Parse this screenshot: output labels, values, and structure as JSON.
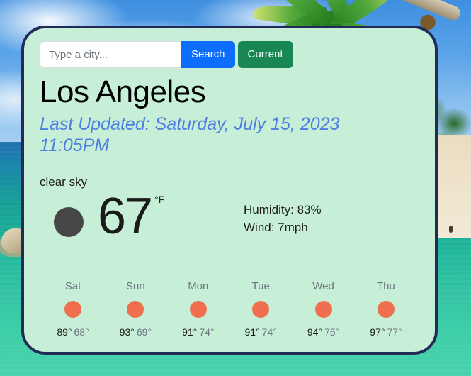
{
  "background": {
    "scene": "tropical-beach-palm-tree",
    "sky_color": "#5aa3e8",
    "ocean_color": "#2fb9a8",
    "sand_color": "#efe4cc"
  },
  "card": {
    "background_color": "#c7efd7",
    "border_color": "#222b58"
  },
  "search": {
    "placeholder": "Type a city...",
    "value": "",
    "search_label": "Search",
    "current_label": "Current",
    "search_color": "#0d6efd",
    "current_color": "#198754"
  },
  "current": {
    "city": "Los Angeles",
    "last_updated": "Last Updated: Saturday, July 15, 2023 11:05PM",
    "condition": "clear sky",
    "icon": "clear-sky-icon",
    "icon_color": "#464646",
    "temperature": "67",
    "unit": "°F",
    "humidity": "Humidity: 83%",
    "wind": "Wind: 7mph"
  },
  "forecast": {
    "icon_color": "#ef6f4f",
    "days": [
      {
        "name": "Sat",
        "icon": "clear-sky-icon",
        "high": "89°",
        "low": "68°"
      },
      {
        "name": "Sun",
        "icon": "clear-sky-icon",
        "high": "93°",
        "low": "69°"
      },
      {
        "name": "Mon",
        "icon": "clear-sky-icon",
        "high": "91°",
        "low": "74°"
      },
      {
        "name": "Tue",
        "icon": "clear-sky-icon",
        "high": "91°",
        "low": "74°"
      },
      {
        "name": "Wed",
        "icon": "clear-sky-icon",
        "high": "94°",
        "low": "75°"
      },
      {
        "name": "Thu",
        "icon": "clear-sky-icon",
        "high": "97°",
        "low": "77°"
      }
    ]
  }
}
